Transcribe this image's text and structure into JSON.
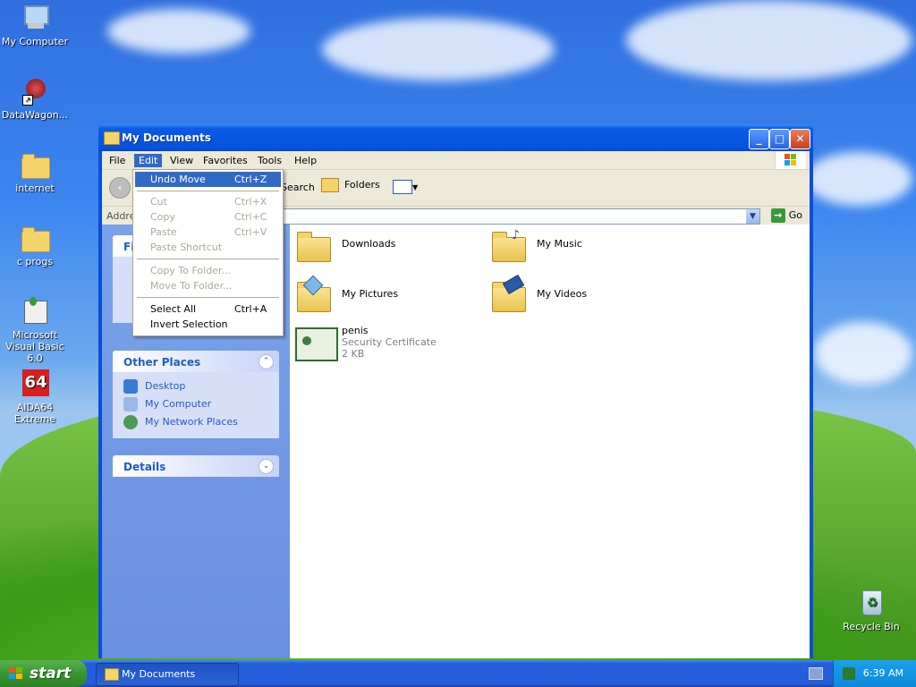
{
  "desktop": {
    "icons": [
      {
        "label": "My Computer",
        "icon": "my-computer-icon"
      },
      {
        "label": "DataWagon...",
        "icon": "datawagon-icon"
      },
      {
        "label": "internet",
        "icon": "folder-icon"
      },
      {
        "label": "c progs",
        "icon": "folder-icon"
      },
      {
        "label": "Microsoft Visual Basic 6.0",
        "icon": "visual-basic-icon"
      },
      {
        "label": "AIDA64 Extreme",
        "icon": "aida64-icon",
        "badge": "64"
      },
      {
        "label": "Recycle Bin",
        "icon": "recycle-bin-icon"
      }
    ]
  },
  "window": {
    "title": "My Documents",
    "controls": {
      "minimize": "_",
      "maximize": "□",
      "close": "✕"
    },
    "menu": [
      "File",
      "Edit",
      "View",
      "Favorites",
      "Tools",
      "Help"
    ],
    "toolbar": {
      "search": "Search",
      "folders": "Folders"
    },
    "address": {
      "label": "Address",
      "go": "Go"
    },
    "left_panels": {
      "file_tasks_peek": "Fi",
      "other_places": {
        "title": "Other Places",
        "links": [
          "Desktop",
          "My Computer",
          "My Network Places"
        ]
      },
      "details": {
        "title": "Details"
      }
    },
    "items": [
      {
        "name": "Downloads",
        "type": "folder"
      },
      {
        "name": "My Music",
        "type": "folder"
      },
      {
        "name": "My Pictures",
        "type": "folder"
      },
      {
        "name": "My Videos",
        "type": "folder"
      },
      {
        "name": "penis",
        "subtitle": "Security Certificate",
        "size": "2 KB",
        "type": "certificate"
      }
    ]
  },
  "edit_menu": {
    "items": [
      {
        "label": "Undo Move",
        "shortcut": "Ctrl+Z",
        "state": "highlighted"
      },
      {
        "label": "Cut",
        "shortcut": "Ctrl+X",
        "state": "disabled"
      },
      {
        "label": "Copy",
        "shortcut": "Ctrl+C",
        "state": "disabled"
      },
      {
        "label": "Paste",
        "shortcut": "Ctrl+V",
        "state": "disabled"
      },
      {
        "label": "Paste Shortcut",
        "shortcut": "",
        "state": "disabled"
      },
      {
        "label": "Copy To Folder...",
        "shortcut": "",
        "state": "disabled"
      },
      {
        "label": "Move To Folder...",
        "shortcut": "",
        "state": "disabled"
      },
      {
        "label": "Select All",
        "shortcut": "Ctrl+A",
        "state": "enabled"
      },
      {
        "label": "Invert Selection",
        "shortcut": "",
        "state": "enabled"
      }
    ]
  },
  "taskbar": {
    "start": "start",
    "tasks": [
      "My Documents"
    ],
    "clock": "6:39 AM"
  },
  "colors": {
    "titlebar": "#0554e0",
    "menu_highlight": "#316ac5",
    "link": "#215dc6",
    "start_green": "#3a9632"
  }
}
